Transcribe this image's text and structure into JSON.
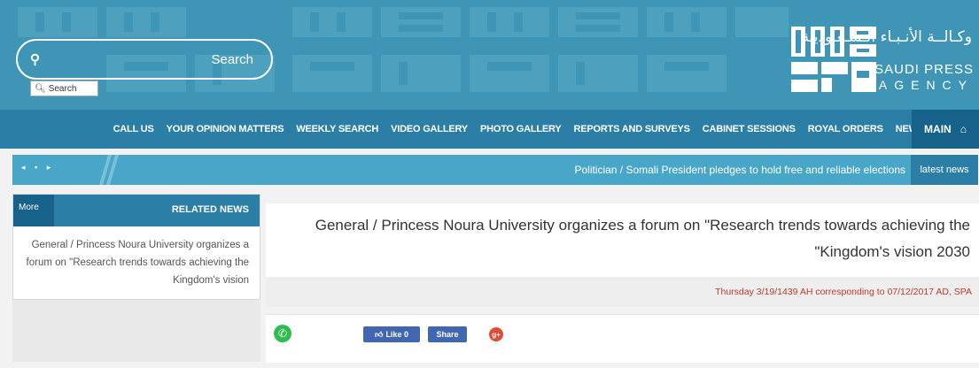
{
  "header": {
    "search_placeholder": "Search",
    "search_button_label": "Search",
    "logo_arabic": "وكـالــة الأنـبـاء الـسـعـوديـة",
    "logo_english_line1": "SAUDI PRESS",
    "logo_english_line2": "AGENCY"
  },
  "nav": {
    "items": [
      "CALL US",
      "YOUR OPINION MATTERS",
      "WEEKLY SEARCH",
      "VIDEO GALLERY",
      "PHOTO GALLERY",
      "REPORTS AND SURVEYS",
      "CABINET SESSIONS",
      "ROYAL ORDERS",
      "NEWS"
    ],
    "main_label": "MAIN"
  },
  "ticker": {
    "headline": "Politician / Somali President pledges to hold free and reliable elections",
    "latest_label": "latest news"
  },
  "related": {
    "more_label": "More",
    "title": "RELATED NEWS",
    "item": "General / Princess Noura University organizes a forum on \"Research trends towards achieving the Kingdom's vision"
  },
  "article": {
    "title_line1": "General / Princess Noura University organizes a forum on \"Research trends towards achieving the",
    "title_line2": "\"Kingdom's vision 2030",
    "date": "Thursday 3/19/1439 AH corresponding to 07/12/2017 AD, SPA"
  },
  "share": {
    "like_label": "Like 0",
    "share_label": "Share"
  },
  "colors": {
    "banner": "#3f95b5",
    "nav": "#2b7fa6",
    "nav_active": "#17628a",
    "ticker": "#48a6c8",
    "date_red": "#c0392b"
  }
}
